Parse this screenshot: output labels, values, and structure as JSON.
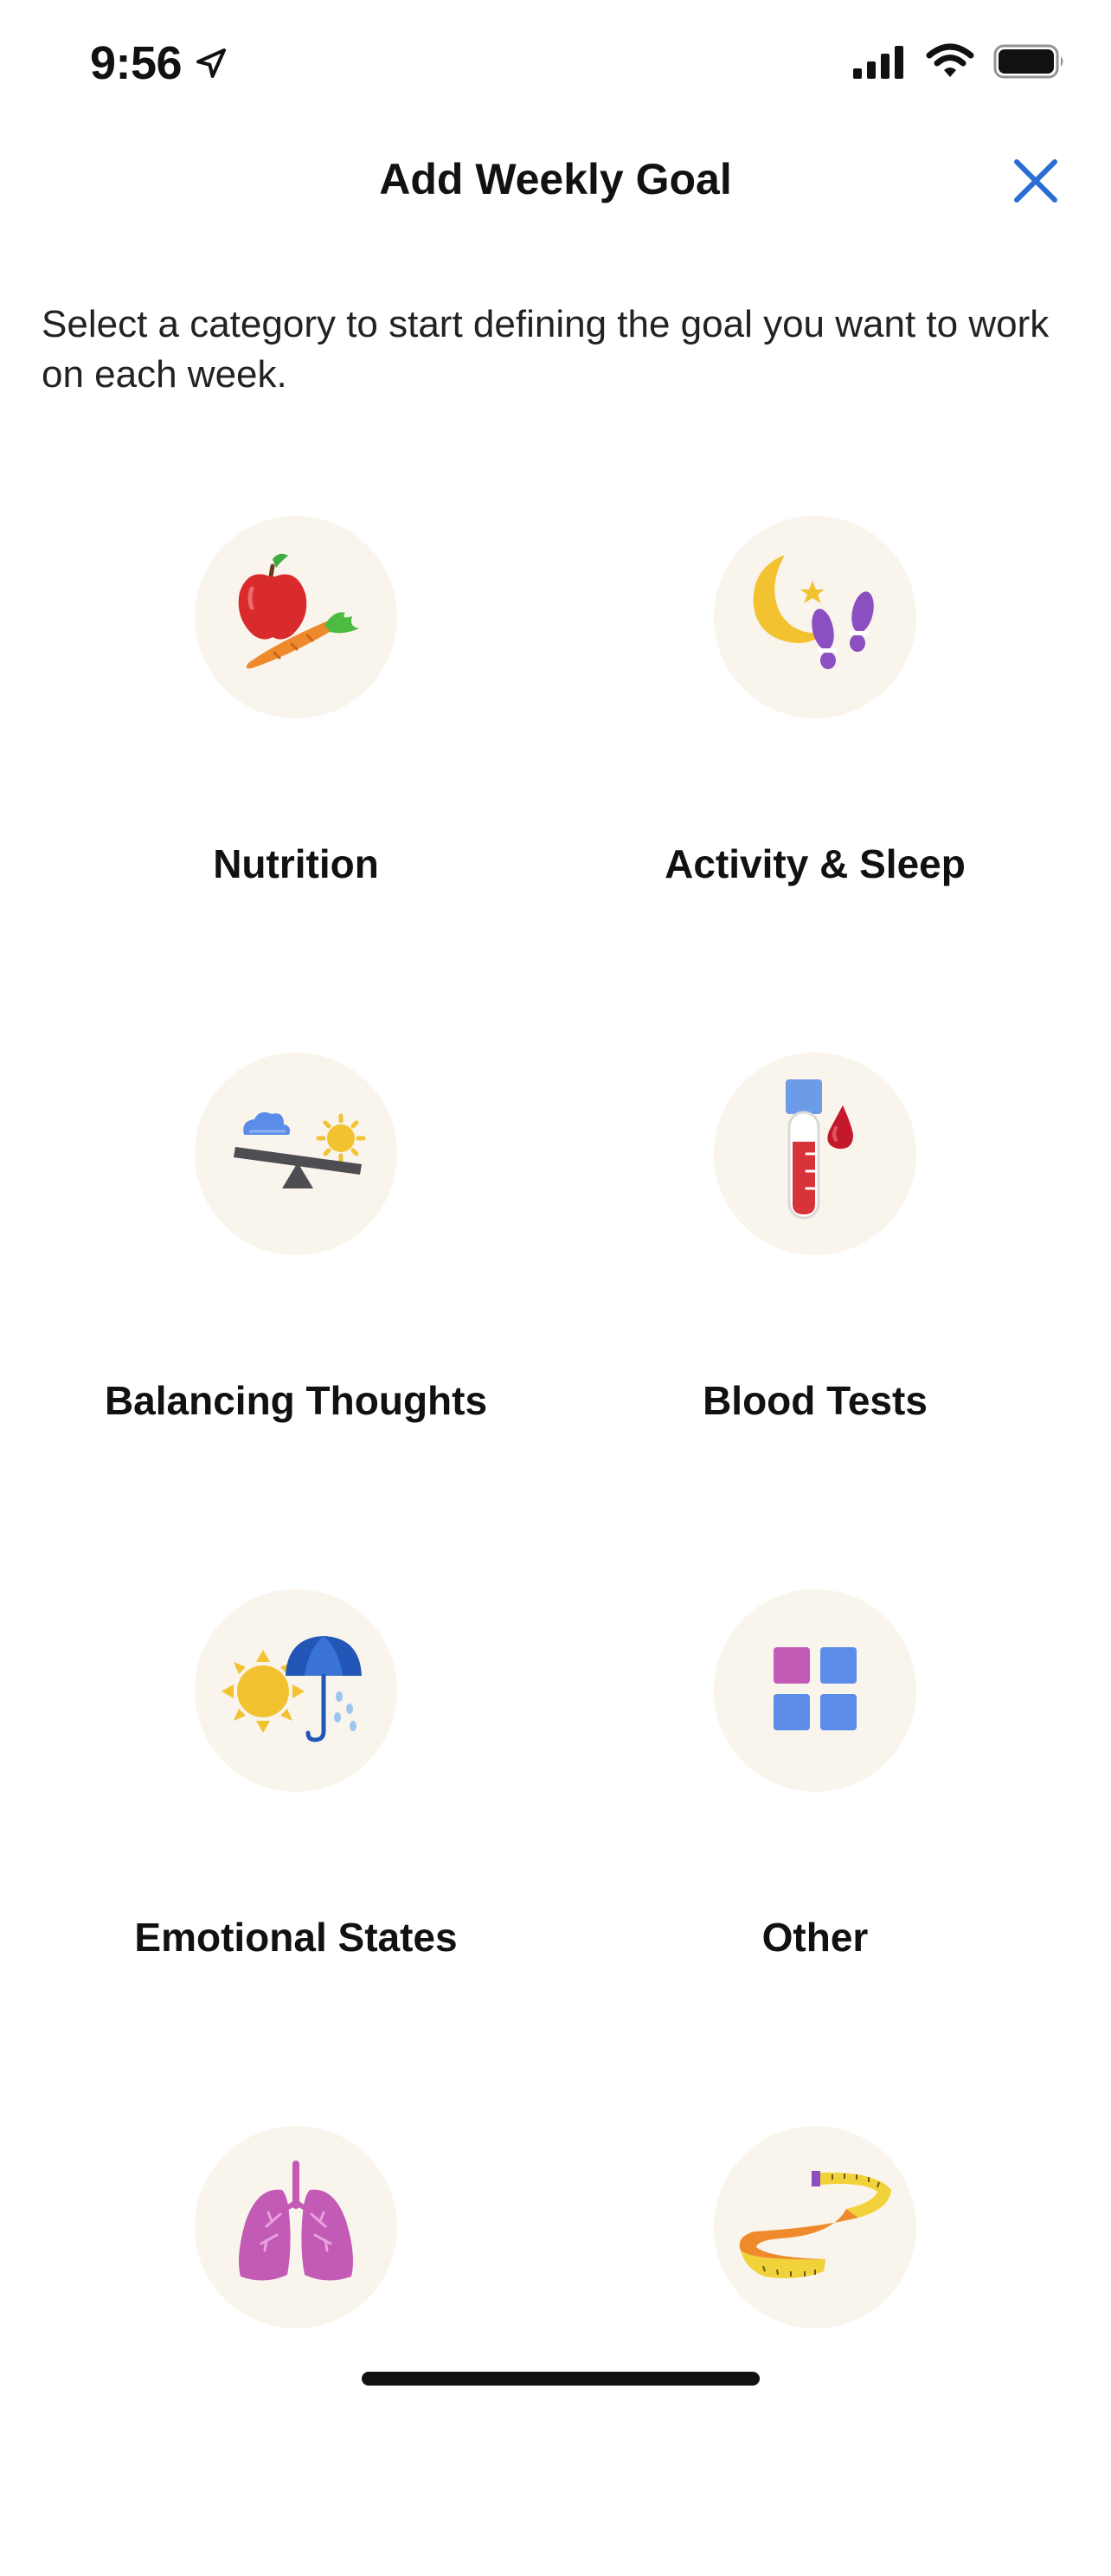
{
  "status_bar": {
    "time": "9:56",
    "icons": [
      "location-arrow-icon",
      "cellular-signal-icon",
      "wifi-icon",
      "battery-icon"
    ]
  },
  "header": {
    "title": "Add Weekly Goal",
    "close_icon": "close-icon",
    "accent_color": "#2a6dd4"
  },
  "description": "Select a category to start defining the goal you want to work on each week.",
  "categories": [
    {
      "label": "Nutrition",
      "icon": "apple-carrot-icon"
    },
    {
      "label": "Activity & Sleep",
      "icon": "moon-footprints-icon"
    },
    {
      "label": "Balancing Thoughts",
      "icon": "seesaw-cloud-sun-icon"
    },
    {
      "label": "Blood Tests",
      "icon": "test-tube-blood-drop-icon"
    },
    {
      "label": "Emotional States",
      "icon": "sun-umbrella-icon"
    },
    {
      "label": "Other",
      "icon": "grid-squares-icon"
    },
    {
      "label": "",
      "icon": "lungs-icon"
    },
    {
      "label": "",
      "icon": "measuring-tape-icon"
    }
  ],
  "colors": {
    "circle_background": "#f9f4ec",
    "text": "#111111"
  }
}
